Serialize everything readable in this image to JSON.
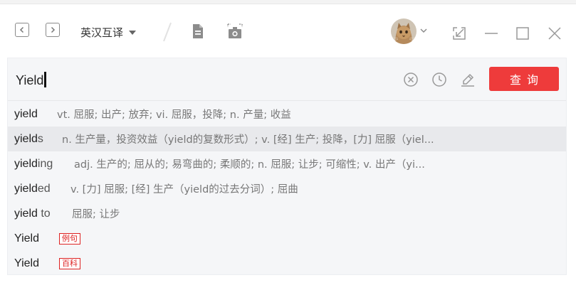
{
  "app": {
    "mode_label": "英汉互译"
  },
  "search": {
    "query": "Yield",
    "button_label": "查询"
  },
  "suggestions": [
    {
      "bold": "yield",
      "rest": "",
      "desc": "vt. 屈服; 出产; 放弃; vi. 屈服，投降; n. 产量; 收益",
      "tag": ""
    },
    {
      "bold": "yield",
      "rest": "s",
      "desc": "n. 生产量，投资效益（yield的复数形式）; v. [经] 生产; 投降，[力] 屈服（yiel...",
      "tag": ""
    },
    {
      "bold": "yield",
      "rest": "ing",
      "desc": "adj. 生产的; 屈从的; 易弯曲的; 柔顺的; n. 屈服; 让步; 可缩性; v. 出产（yi...",
      "tag": ""
    },
    {
      "bold": "yield",
      "rest": "ed",
      "desc": "v. [力] 屈服; [经] 生产（yield的过去分词）; 屈曲",
      "tag": ""
    },
    {
      "bold": "yield",
      "rest": " to",
      "desc": "屈服; 让步",
      "tag": ""
    },
    {
      "bold": "Yield",
      "rest": "",
      "desc": "",
      "tag": "例句"
    },
    {
      "bold": "Yield",
      "rest": "",
      "desc": "",
      "tag": "百科"
    }
  ],
  "colors": {
    "accent": "#ee3b3b",
    "panel": "#f5f6f8",
    "highlight_row": "#e8e9ec"
  },
  "icons": {
    "back": "chevron-left-icon",
    "forward": "chevron-right-icon",
    "document": "document-icon",
    "screenshot": "camera-icon",
    "clear": "clear-icon",
    "history": "clock-icon",
    "handwriting": "pen-icon",
    "shrink": "shrink-icon",
    "minimize": "minimize-icon",
    "maximize": "maximize-icon",
    "close": "close-icon"
  }
}
